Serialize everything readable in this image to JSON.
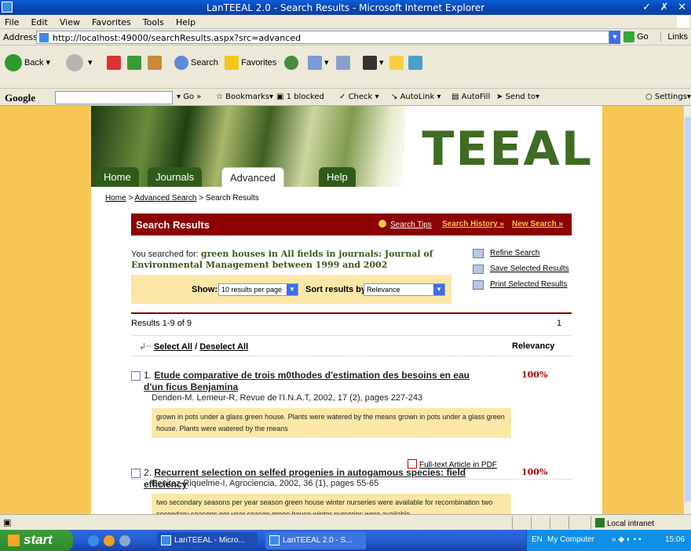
{
  "window": {
    "title": "LanTEEAL 2.0 - Search Results - Microsoft Internet Explorer",
    "controls": "✓ ✗ ✕"
  },
  "menu": [
    "File",
    "Edit",
    "View",
    "Favorites",
    "Tools",
    "Help"
  ],
  "address": {
    "label": "Address",
    "url": "http://localhost:49000/searchResults.aspx?src=advanced",
    "go_label": "Go",
    "links_label": "Links"
  },
  "toolbar": {
    "back": "Back",
    "search": "Search",
    "favorites": "Favorites"
  },
  "googlebar": {
    "logo": "Google",
    "go": "Go",
    "bookmarks": "Bookmarks▾",
    "blocked": "1 blocked",
    "check": "Check ▾",
    "autolink": "AutoLink ▾",
    "autofill": "AutoFill",
    "sendto": "Send to▾",
    "settings": "Settings▾"
  },
  "site": {
    "logo": "TEEAL",
    "tabs": [
      "Home",
      "Journals A-Z",
      "Advanced Search",
      "Help"
    ],
    "active_tab": "Advanced Search"
  },
  "breadcrumb": {
    "home": "Home",
    "sep1": " > ",
    "advanced": "Advanced Search",
    "sep2": " > ",
    "current": "Search Results"
  },
  "results_header": {
    "title": "Search Results",
    "tips": "Search Tips",
    "history": "Search History »",
    "new_search": "New Search »"
  },
  "query": {
    "prefix": "You searched for: ",
    "text": "green houses in All fields in journals: Journal of Environmental Management between 1999 and 2002"
  },
  "actions": {
    "refine": "Refine Search",
    "save": "Save Selected Results",
    "print": "Print Selected Results"
  },
  "filter": {
    "show_label": "Show:",
    "show_value": "10 results per page",
    "sort_label": "Sort results by:",
    "sort_value": "Relevance"
  },
  "summary": {
    "results_text": "Results 1-9 of 9",
    "page": "1"
  },
  "list": {
    "select_all": "Select All",
    "slash": " / ",
    "deselect_all": "Deselect All",
    "relevancy": "Relevancy"
  },
  "results": [
    {
      "num": "1.",
      "title": "Etude comparative de trois m0thodes d'estimation des besoins en eau d'un ficus Benjamina",
      "meta": "Denden-M. Lemeur-R, Revue de l'I.N.A.T, 2002, 17 (2), pages 227-243",
      "snippet": "grown in pots under a glass green house. Plants were watered by the means grown in pots under a glass green house. Plants were watered by the means",
      "relevancy": "100%",
      "pdf": "Full-text Article in PDF"
    },
    {
      "num": "2.",
      "title": "Recurrent selection on selfed progenies in autogamous species: field efficiency",
      "meta": "Benitez-Riquelme-I, Agrociencia, 2002, 36 (1), pages 55-65",
      "snippet": "two secondary seasons per year season green house winter nurseries were available for recombination two secondary seasons per year season green house winter nurseries were available",
      "relevancy": "100%"
    }
  ],
  "statusbar": {
    "zone": "Local intranet"
  },
  "taskbar": {
    "start": "start",
    "tasks": [
      "LanTEEAL - Micro...",
      "LanTEEAL 2.0 - S..."
    ],
    "lang": "EN",
    "mycomputer": "My Computer",
    "time": "15:06"
  }
}
